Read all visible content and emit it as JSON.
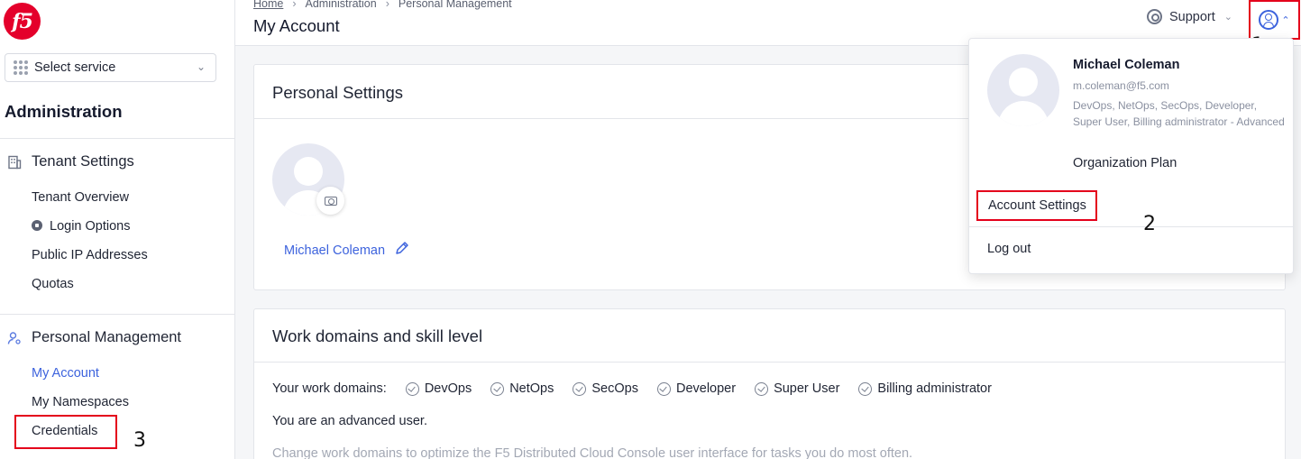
{
  "header": {
    "breadcrumb": [
      "Home",
      "Administration",
      "Personal Management"
    ],
    "page_title": "My Account",
    "support_label": "Support"
  },
  "sidebar": {
    "select_service": "Select service",
    "section_title": "Administration",
    "tenant_settings": {
      "title": "Tenant Settings",
      "items": [
        "Tenant Overview",
        "Login Options",
        "Public IP Addresses",
        "Quotas"
      ]
    },
    "personal_management": {
      "title": "Personal Management",
      "items": [
        "My Account",
        "My Namespaces",
        "Credentials"
      ],
      "active": "My Account"
    }
  },
  "personal_settings": {
    "title": "Personal Settings",
    "user_name": "Michael Coleman"
  },
  "work_domains": {
    "title": "Work domains and skill level",
    "label": "Your work domains:",
    "domains": [
      "DevOps",
      "NetOps",
      "SecOps",
      "Developer",
      "Super User",
      "Billing administrator"
    ],
    "skill_text": "You are an advanced user.",
    "hint": "Change work domains to optimize the F5 Distributed Cloud Console user interface for tasks you do most often."
  },
  "user_menu": {
    "name": "Michael Coleman",
    "email": "m.coleman@f5.com",
    "roles": "DevOps, NetOps, SecOps, Developer, Super User, Billing administrator - Advanced",
    "plan": "Organization Plan",
    "account_settings": "Account Settings",
    "logout": "Log out"
  },
  "annotations": [
    "1",
    "2",
    "3"
  ],
  "logo_text": "f5",
  "colors": {
    "accent": "#3d63dd",
    "brand": "#e4002b",
    "highlight": "#e4001b"
  }
}
